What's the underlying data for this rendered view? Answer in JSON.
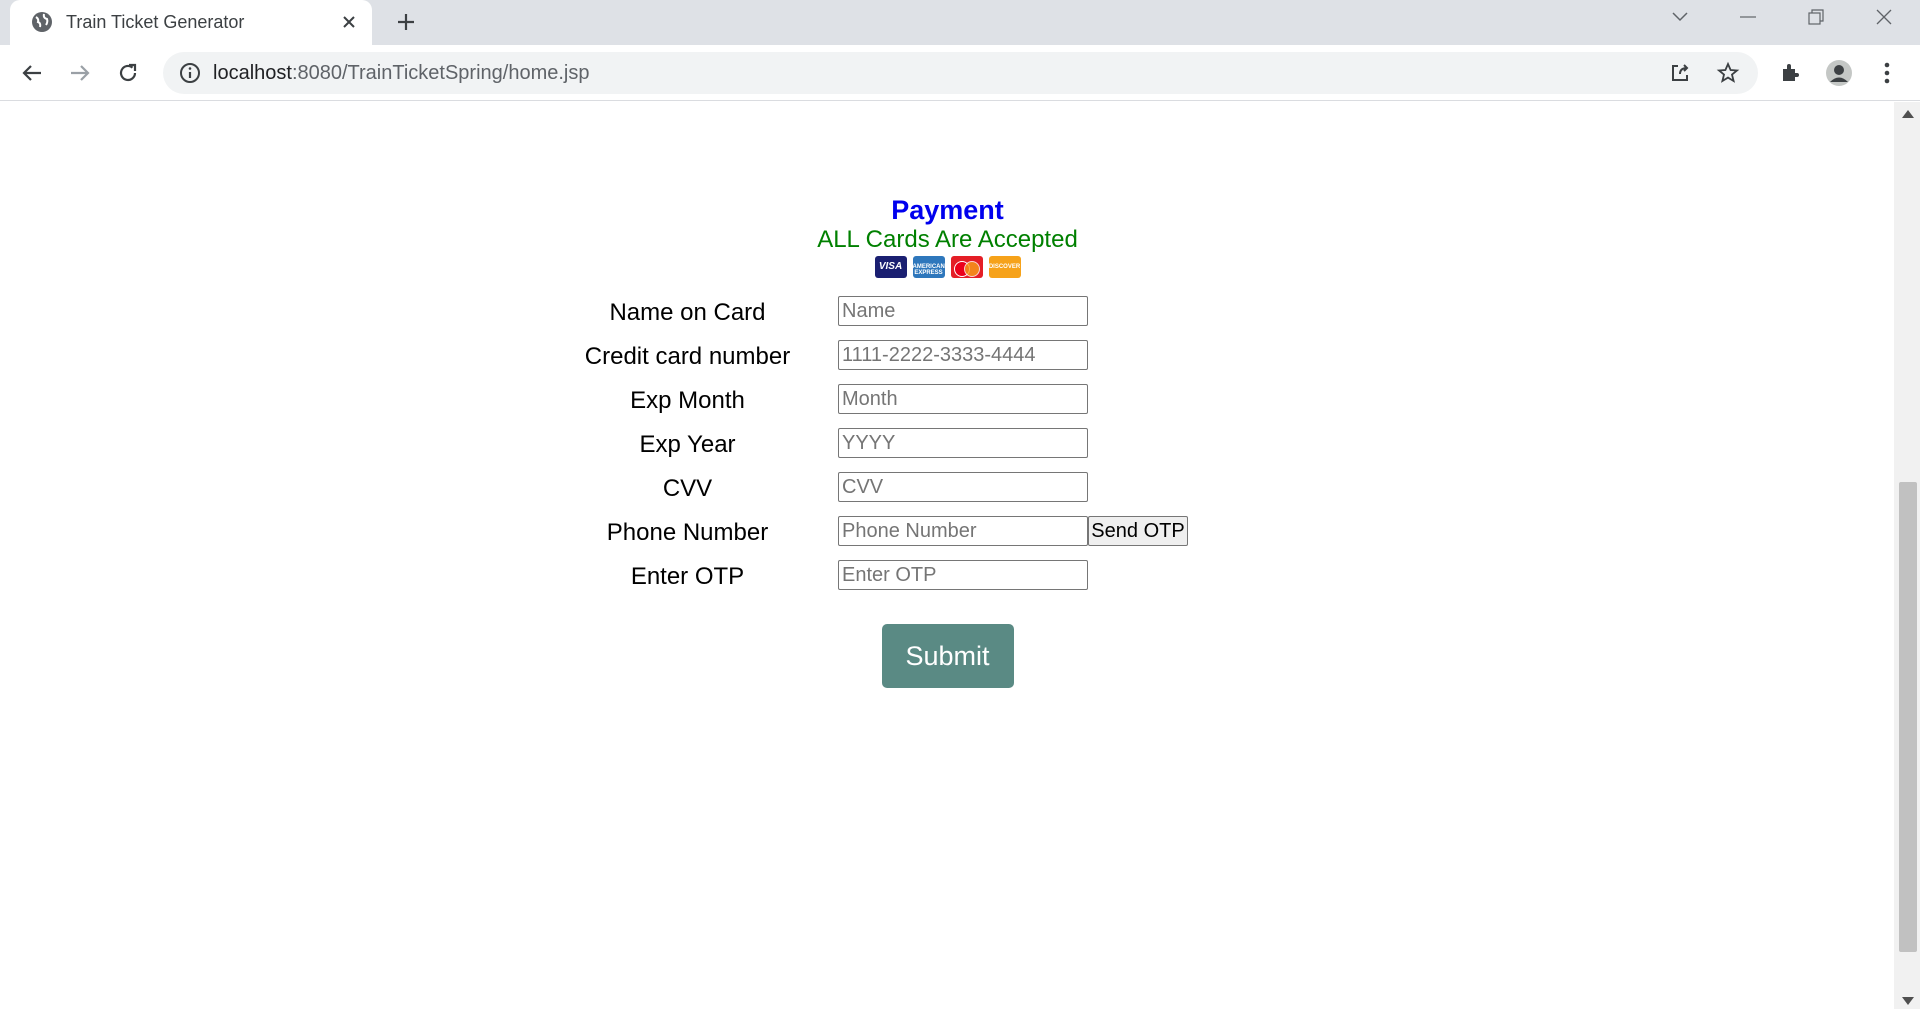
{
  "browser": {
    "tab_title": "Train Ticket Generator",
    "url_host": "localhost",
    "url_rest": ":8080/TrainTicketSpring/home.jsp"
  },
  "payment": {
    "title": "Payment",
    "subtitle": "ALL Cards Are Accepted",
    "cards": [
      {
        "name": "visa",
        "label": "VISA"
      },
      {
        "name": "amex",
        "label": "AMERICAN EXPRESS"
      },
      {
        "name": "mastercard",
        "label": ""
      },
      {
        "name": "discover",
        "label": "DISCOVER"
      }
    ],
    "fields": [
      {
        "label": "Name on Card",
        "placeholder": "Name"
      },
      {
        "label": "Credit card number",
        "placeholder": "1111-2222-3333-4444"
      },
      {
        "label": "Exp Month",
        "placeholder": "Month"
      },
      {
        "label": "Exp Year",
        "placeholder": "YYYY"
      },
      {
        "label": "CVV",
        "placeholder": "CVV"
      },
      {
        "label": "Phone Number",
        "placeholder": "Phone Number"
      },
      {
        "label": "Enter OTP",
        "placeholder": "Enter OTP"
      }
    ],
    "send_otp_label": "Send OTP",
    "submit_label": "Submit"
  },
  "colors": {
    "title": "#0000ee",
    "subtitle": "#008000",
    "submit_bg": "#5a8a84"
  }
}
